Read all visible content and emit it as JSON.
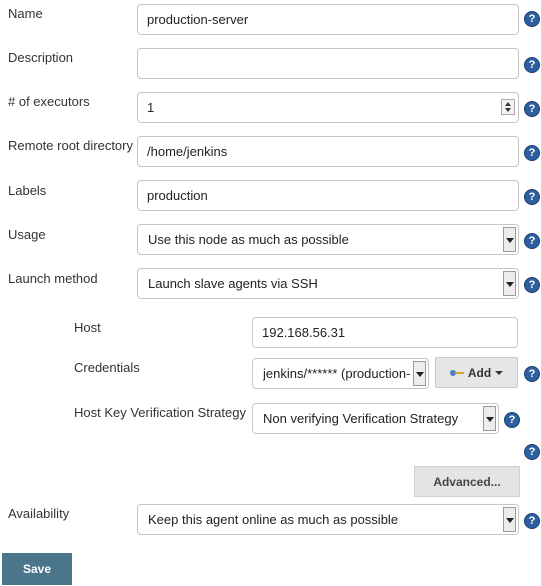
{
  "form": {
    "name": {
      "label": "Name",
      "value": "production-server"
    },
    "description": {
      "label": "Description",
      "value": ""
    },
    "executors": {
      "label": "# of executors",
      "value": "1"
    },
    "remote_root": {
      "label": "Remote root directory",
      "value": "/home/jenkins"
    },
    "labels": {
      "label": "Labels",
      "value": "production"
    },
    "usage": {
      "label": "Usage",
      "value": "Use this node as much as possible"
    },
    "launch_method": {
      "label": "Launch method",
      "value": "Launch slave agents via SSH"
    },
    "host": {
      "label": "Host",
      "value": "192.168.56.31"
    },
    "credentials": {
      "label": "Credentials",
      "value": "jenkins/****** (production-"
    },
    "host_key": {
      "label": "Host Key Verification Strategy",
      "value": "Non verifying Verification Strategy"
    },
    "availability": {
      "label": "Availability",
      "value": "Keep this agent online as much as possible"
    }
  },
  "buttons": {
    "add": "Add",
    "advanced": "Advanced...",
    "save": "Save"
  },
  "help_glyph": "?",
  "icons": {
    "help": "help-icon",
    "key": "key-icon",
    "select_arrow": "chevron-down-icon"
  }
}
